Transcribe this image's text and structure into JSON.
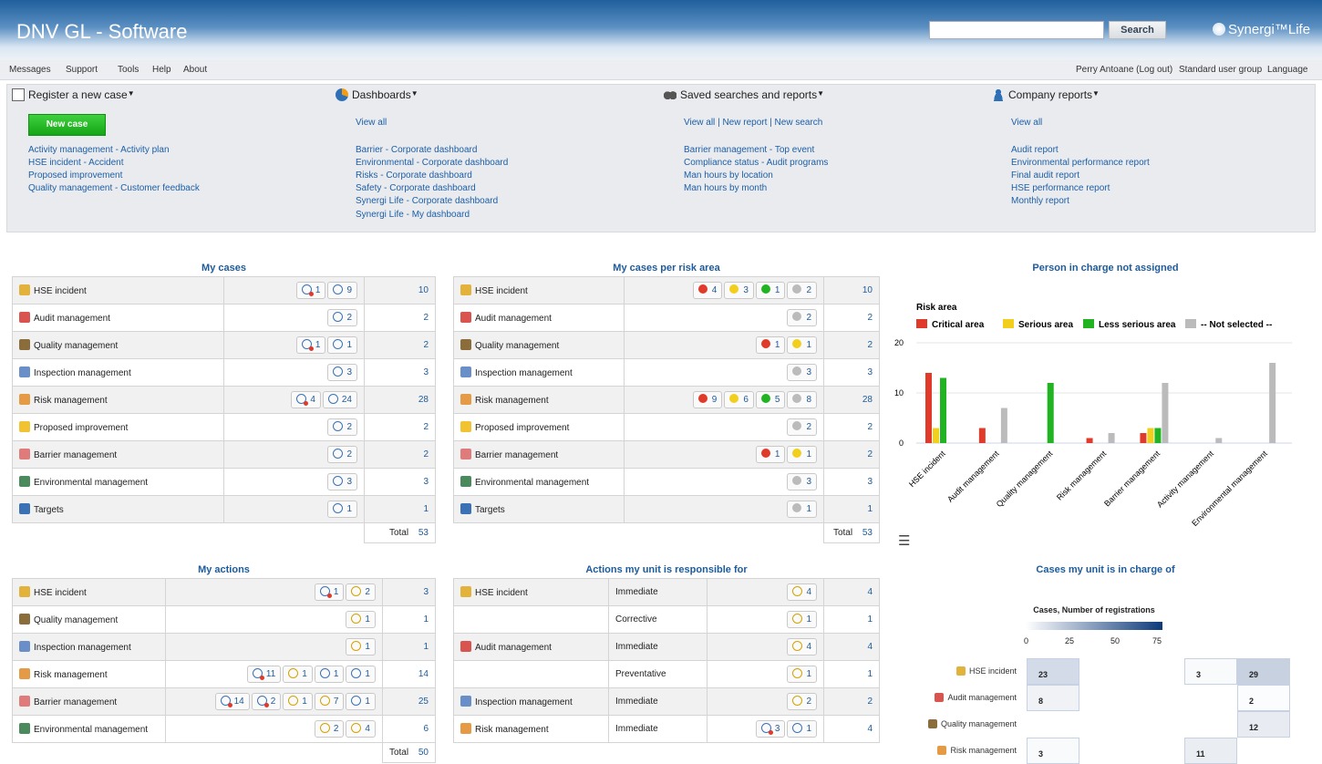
{
  "header": {
    "app_title": "DNV GL - Software",
    "search_placeholder": "",
    "search_button": "Search",
    "brand": "Synergi™Life"
  },
  "topnav": {
    "left": [
      "Messages",
      "Support",
      "Tools",
      "Help",
      "About"
    ],
    "right": [
      "Perry Antoane (Log out)",
      "Standard user group",
      "Language"
    ]
  },
  "panel": {
    "register": {
      "title": "Register a new case",
      "new_case": "New case",
      "links": [
        "Activity management - Activity plan",
        "HSE incident - Accident",
        "Proposed improvement",
        "Quality management - Customer feedback"
      ]
    },
    "dashboards": {
      "title": "Dashboards",
      "view_all": "View all",
      "links": [
        "Barrier - Corporate dashboard",
        "Environmental - Corporate dashboard",
        "Risks - Corporate dashboard",
        "Safety - Corporate dashboard",
        "Synergi Life - Corporate dashboard",
        "Synergi Life - My dashboard"
      ]
    },
    "saved": {
      "title": "Saved searches and reports",
      "view_all": "View all",
      "new_report": "New report",
      "new_search": "New search",
      "sep": "|",
      "links": [
        "Barrier management - Top event",
        "Compliance status - Audit programs",
        "Man hours by location",
        "Man hours by month"
      ]
    },
    "company": {
      "title": "Company reports",
      "view_all": "View all",
      "links": [
        "Audit report",
        "Environmental performance report",
        "Final audit report",
        "HSE performance report",
        "Monthly report"
      ]
    }
  },
  "my_cases": {
    "title": "My cases",
    "total_label": "Total",
    "total": "53",
    "rows": [
      {
        "name": "HSE incident",
        "icon": "trophy-icon",
        "ic": "#e2b23a",
        "chips": [
          [
            "red",
            "1"
          ],
          [
            "blue",
            "9"
          ]
        ],
        "count": "10"
      },
      {
        "name": "Audit management",
        "icon": "audit-icon",
        "ic": "#d9534f",
        "chips": [
          [
            "blue",
            "2"
          ]
        ],
        "count": "2"
      },
      {
        "name": "Quality management",
        "icon": "quality-icon",
        "ic": "#8a6d3b",
        "chips": [
          [
            "red",
            "1"
          ],
          [
            "blue",
            "1"
          ]
        ],
        "count": "2"
      },
      {
        "name": "Inspection management",
        "icon": "inspection-icon",
        "ic": "#6a8fc8",
        "chips": [
          [
            "blue",
            "3"
          ]
        ],
        "count": "3"
      },
      {
        "name": "Risk management",
        "icon": "risk-icon",
        "ic": "#e59a45",
        "chips": [
          [
            "red",
            "4"
          ],
          [
            "blue",
            "24"
          ]
        ],
        "count": "28"
      },
      {
        "name": "Proposed improvement",
        "icon": "lightbulb-icon",
        "ic": "#f1c232",
        "chips": [
          [
            "blue",
            "2"
          ]
        ],
        "count": "2"
      },
      {
        "name": "Barrier management",
        "icon": "barrier-icon",
        "ic": "#e07b7b",
        "chips": [
          [
            "blue",
            "2"
          ]
        ],
        "count": "2"
      },
      {
        "name": "Environmental management",
        "icon": "tree-icon",
        "ic": "#4b8a5c",
        "chips": [
          [
            "blue",
            "3"
          ]
        ],
        "count": "3"
      },
      {
        "name": "Targets",
        "icon": "target-icon",
        "ic": "#3a72b5",
        "chips": [
          [
            "blue",
            "1"
          ]
        ],
        "count": "1"
      }
    ]
  },
  "risk_area": {
    "title": "My cases per risk area",
    "total_label": "Total",
    "total": "53",
    "rows": [
      {
        "name": "HSE incident",
        "icon": "trophy-icon",
        "ic": "#e2b23a",
        "chips": [
          [
            "#e03a2a",
            "4"
          ],
          [
            "#f2cf1d",
            "3"
          ],
          [
            "#21b321",
            "1"
          ],
          [
            "#bbbbbb",
            "2"
          ]
        ],
        "count": "10"
      },
      {
        "name": "Audit management",
        "icon": "audit-icon",
        "ic": "#d9534f",
        "chips": [
          [
            "#bbbbbb",
            "2"
          ]
        ],
        "count": "2"
      },
      {
        "name": "Quality management",
        "icon": "quality-icon",
        "ic": "#8a6d3b",
        "chips": [
          [
            "#e03a2a",
            "1"
          ],
          [
            "#f2cf1d",
            "1"
          ]
        ],
        "count": "2"
      },
      {
        "name": "Inspection management",
        "icon": "inspection-icon",
        "ic": "#6a8fc8",
        "chips": [
          [
            "#bbbbbb",
            "3"
          ]
        ],
        "count": "3"
      },
      {
        "name": "Risk management",
        "icon": "risk-icon",
        "ic": "#e59a45",
        "chips": [
          [
            "#e03a2a",
            "9"
          ],
          [
            "#f2cf1d",
            "6"
          ],
          [
            "#21b321",
            "5"
          ],
          [
            "#bbbbbb",
            "8"
          ]
        ],
        "count": "28"
      },
      {
        "name": "Proposed improvement",
        "icon": "lightbulb-icon",
        "ic": "#f1c232",
        "chips": [
          [
            "#bbbbbb",
            "2"
          ]
        ],
        "count": "2"
      },
      {
        "name": "Barrier management",
        "icon": "barrier-icon",
        "ic": "#e07b7b",
        "chips": [
          [
            "#e03a2a",
            "1"
          ],
          [
            "#f2cf1d",
            "1"
          ]
        ],
        "count": "2"
      },
      {
        "name": "Environmental management",
        "icon": "tree-icon",
        "ic": "#4b8a5c",
        "chips": [
          [
            "#bbbbbb",
            "3"
          ]
        ],
        "count": "3"
      },
      {
        "name": "Targets",
        "icon": "target-icon",
        "ic": "#3a72b5",
        "chips": [
          [
            "#bbbbbb",
            "1"
          ]
        ],
        "count": "1"
      }
    ]
  },
  "my_actions": {
    "title": "My actions",
    "total_label": "Total",
    "total": "50",
    "rows": [
      {
        "name": "HSE incident",
        "icon": "trophy-icon",
        "ic": "#e2b23a",
        "chips": [
          [
            "red",
            "1"
          ],
          [
            "yellow",
            "2"
          ]
        ],
        "count": "3"
      },
      {
        "name": "Quality management",
        "icon": "quality-icon",
        "ic": "#8a6d3b",
        "chips": [
          [
            "yellow",
            "1"
          ]
        ],
        "count": "1"
      },
      {
        "name": "Inspection management",
        "icon": "inspection-icon",
        "ic": "#6a8fc8",
        "chips": [
          [
            "yellow",
            "1"
          ]
        ],
        "count": "1"
      },
      {
        "name": "Risk management",
        "icon": "risk-icon",
        "ic": "#e59a45",
        "chips": [
          [
            "red",
            "11"
          ],
          [
            "yellow",
            "1"
          ],
          [
            "blue",
            "1"
          ],
          [
            "blue",
            "1"
          ]
        ],
        "count": "14"
      },
      {
        "name": "Barrier management",
        "icon": "barrier-icon",
        "ic": "#e07b7b",
        "chips": [
          [
            "red",
            "14"
          ],
          [
            "red",
            "2"
          ],
          [
            "yellow",
            "1"
          ],
          [
            "yellow",
            "7"
          ],
          [
            "blue",
            "1"
          ]
        ],
        "count": "25"
      },
      {
        "name": "Environmental management",
        "icon": "tree-icon",
        "ic": "#4b8a5c",
        "chips": [
          [
            "yellow",
            "2"
          ],
          [
            "yellow",
            "4"
          ]
        ],
        "count": "6"
      }
    ]
  },
  "unit_actions": {
    "title": "Actions my unit is responsible for",
    "rows": [
      {
        "name": "HSE incident",
        "icon": "trophy-icon",
        "ic": "#e2b23a",
        "type": "Immediate",
        "chips": [
          [
            "yellow",
            "4"
          ]
        ],
        "count": "4"
      },
      {
        "name": "",
        "icon": "",
        "ic": "",
        "type": "Corrective",
        "chips": [
          [
            "yellow",
            "1"
          ]
        ],
        "count": "1"
      },
      {
        "name": "Audit management",
        "icon": "audit-icon",
        "ic": "#d9534f",
        "type": "Immediate",
        "chips": [
          [
            "yellow",
            "4"
          ]
        ],
        "count": "4"
      },
      {
        "name": "",
        "icon": "",
        "ic": "",
        "type": "Preventative",
        "chips": [
          [
            "yellow",
            "1"
          ]
        ],
        "count": "1"
      },
      {
        "name": "Inspection management",
        "icon": "inspection-icon",
        "ic": "#6a8fc8",
        "type": "Immediate",
        "chips": [
          [
            "yellow",
            "2"
          ]
        ],
        "count": "2"
      },
      {
        "name": "Risk management",
        "icon": "risk-icon",
        "ic": "#e59a45",
        "type": "Immediate",
        "chips": [
          [
            "red",
            "3"
          ],
          [
            "blue",
            "1"
          ]
        ],
        "count": "4"
      }
    ]
  },
  "chart_data": [
    {
      "type": "bar",
      "title": "Person in charge not assigned",
      "legend_title": "Risk area",
      "legend_placement": "top-left",
      "ylim": [
        0,
        20
      ],
      "yticks": [
        "0",
        "10",
        "20"
      ],
      "categories": [
        "HSE incident",
        "Audit management",
        "Quality management",
        "Risk management",
        "Barrier management",
        "Activity management",
        "Environmental management"
      ],
      "series": [
        {
          "name": "Critical area",
          "color": "#e03a2a",
          "values": [
            14,
            3,
            0,
            1,
            2,
            0,
            0
          ]
        },
        {
          "name": "Serious area",
          "color": "#f2cf1d",
          "values": [
            3,
            0,
            0,
            0,
            3,
            0,
            0
          ]
        },
        {
          "name": "Less serious area",
          "color": "#21b321",
          "values": [
            13,
            0,
            12,
            0,
            3,
            0,
            0
          ]
        },
        {
          "name": "-- Not selected --",
          "color": "#bbbbbb",
          "values": [
            0,
            7,
            0,
            2,
            12,
            1,
            16
          ]
        }
      ]
    },
    {
      "type": "heatmap",
      "title": "Cases my unit is in charge of",
      "colorbar_title": "Cases, Number of registrations",
      "colorbar_ticks": [
        "0",
        "25",
        "50",
        "75"
      ],
      "rows": [
        "HSE incident",
        "Audit management",
        "Quality management",
        "Risk management"
      ],
      "cells": [
        {
          "row": 0,
          "col": 0,
          "value": "23"
        },
        {
          "row": 0,
          "col": 3,
          "value": "3"
        },
        {
          "row": 0,
          "col": 4,
          "value": "29"
        },
        {
          "row": 1,
          "col": 0,
          "value": "8"
        },
        {
          "row": 1,
          "col": 4,
          "value": "2"
        },
        {
          "row": 2,
          "col": 4,
          "value": "12"
        },
        {
          "row": 3,
          "col": 0,
          "value": "3"
        },
        {
          "row": 3,
          "col": 3,
          "value": "11"
        }
      ]
    }
  ]
}
